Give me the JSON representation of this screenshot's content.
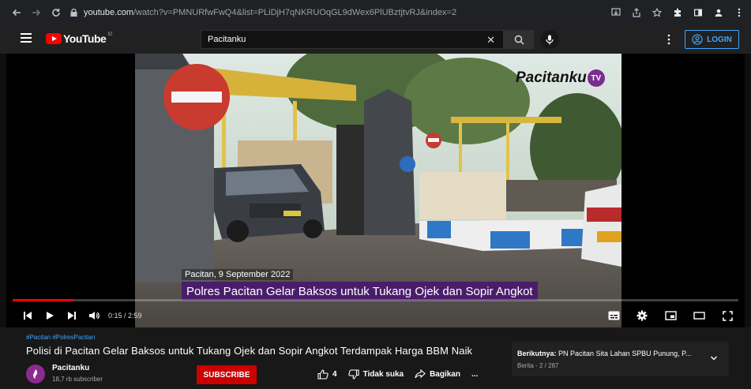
{
  "browser": {
    "url_host": "youtube.com",
    "url_rest": "/watch?v=PMNURfwFwQ4&list=PLiDjH7qNKRUOqGL9dWex6PlUBztjtvRJ&index=2"
  },
  "header": {
    "logo_text": "YouTube",
    "logo_region": "ID",
    "search_value": "Pacitanku",
    "login_label": "LOGIN"
  },
  "player": {
    "watermark_text": "Pacitanku",
    "watermark_badge": "TV",
    "date_overlay": "Pacitan, 9 September 2022",
    "title_overlay": "Polres Pacitan Gelar Baksos untuk Tukang Ojek dan Sopir Angkot",
    "current_time": "0:15",
    "duration": "2:59",
    "time_display": "0:15 / 2:59",
    "progress_fraction": 0.084
  },
  "video": {
    "hashtags": "#Pacitan #PolresPacitan",
    "title": "Polisi di Pacitan Gelar Baksos untuk Tukang Ojek dan Sopir Angkot Terdampak Harga BBM Naik",
    "channel_name": "Pacitanku",
    "subscriber_count": "18,7 rb subscriber",
    "subscribe_label": "SUBSCRIBE",
    "like_count": "4",
    "dislike_label": "Tidak suka",
    "share_label": "Bagikan",
    "more_label": "..."
  },
  "up_next": {
    "prefix": "Berikutnya:",
    "title": "PN Pacitan Sita Lahan SPBU Punung, P...",
    "playlist_info": "Berita - 2 / 287"
  },
  "colors": {
    "accent_blue": "#3ea6ff",
    "youtube_red": "#ff0000",
    "subscribe_red": "#cc0000",
    "banner_purple": "#4a1d6b"
  }
}
